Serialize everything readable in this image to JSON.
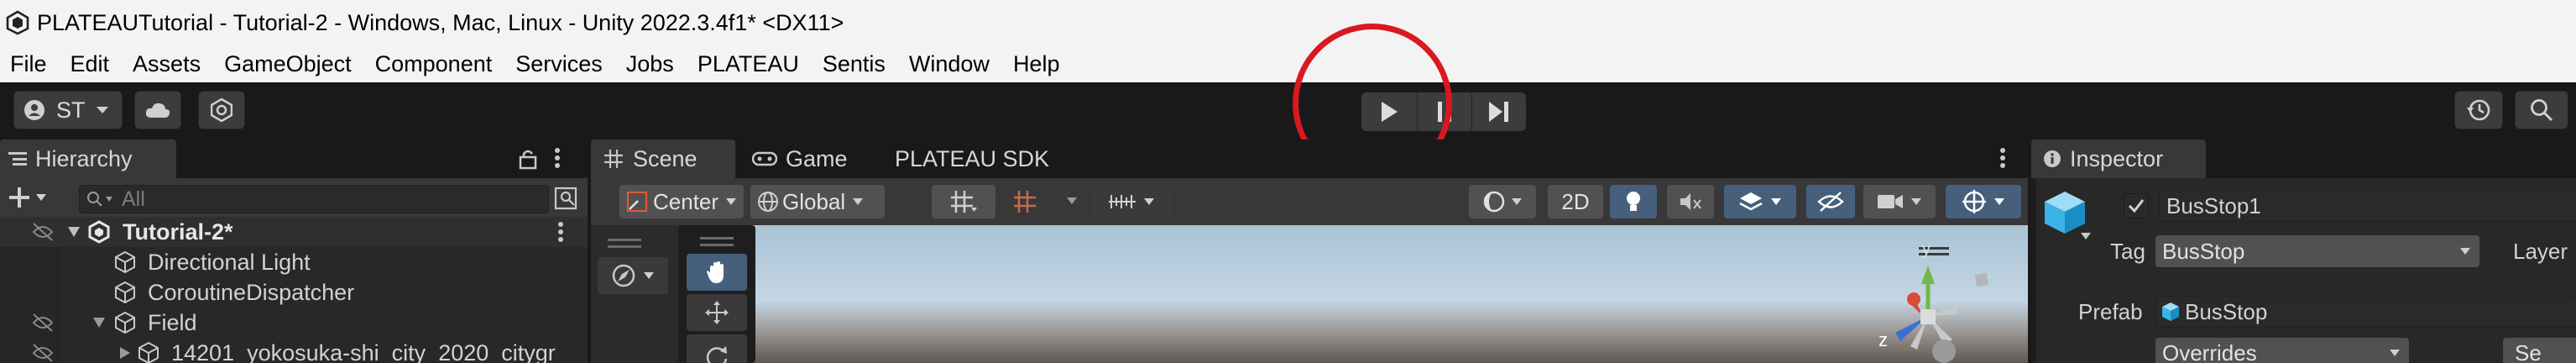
{
  "window": {
    "title": "PLATEAUTutorial - Tutorial-2 - Windows, Mac, Linux - Unity 2022.3.4f1* <DX11>"
  },
  "menu": [
    "File",
    "Edit",
    "Assets",
    "GameObject",
    "Component",
    "Services",
    "Jobs",
    "PLATEAU",
    "Sentis",
    "Window",
    "Help"
  ],
  "toolbar": {
    "account_label": "ST",
    "icons": [
      "account-icon",
      "cloud-icon",
      "collab-icon",
      "play-icon",
      "pause-icon",
      "step-icon",
      "history-icon",
      "search-icon"
    ],
    "annotation_color": "#d9181f"
  },
  "hierarchy": {
    "tab_label": "Hierarchy",
    "search_placeholder": "All",
    "scene_name": "Tutorial-2*",
    "items": [
      {
        "label": "Directional Light"
      },
      {
        "label": "CoroutineDispatcher"
      },
      {
        "label": "Field"
      },
      {
        "label": "14201_yokosuka-shi_city_2020_citygr"
      }
    ]
  },
  "scene_view": {
    "tabs": [
      {
        "label": "Scene",
        "icon": "grid-icon"
      },
      {
        "label": "Game",
        "icon": "gamepad-icon"
      },
      {
        "label": "PLATEAU SDK",
        "icon": ""
      }
    ],
    "pivot_label": "Center",
    "space_label": "Global",
    "mode_2d_label": "2D",
    "gizmo_axes": {
      "y": "y",
      "z": "z"
    }
  },
  "inspector": {
    "tab_label": "Inspector",
    "object_name": "BusStop1",
    "tag_label": "Tag",
    "tag_value": "BusStop",
    "layer_label": "Layer",
    "prefab_label": "Prefab",
    "prefab_value": "BusStop",
    "overrides_label": "Overrides",
    "select_label": "Se"
  }
}
